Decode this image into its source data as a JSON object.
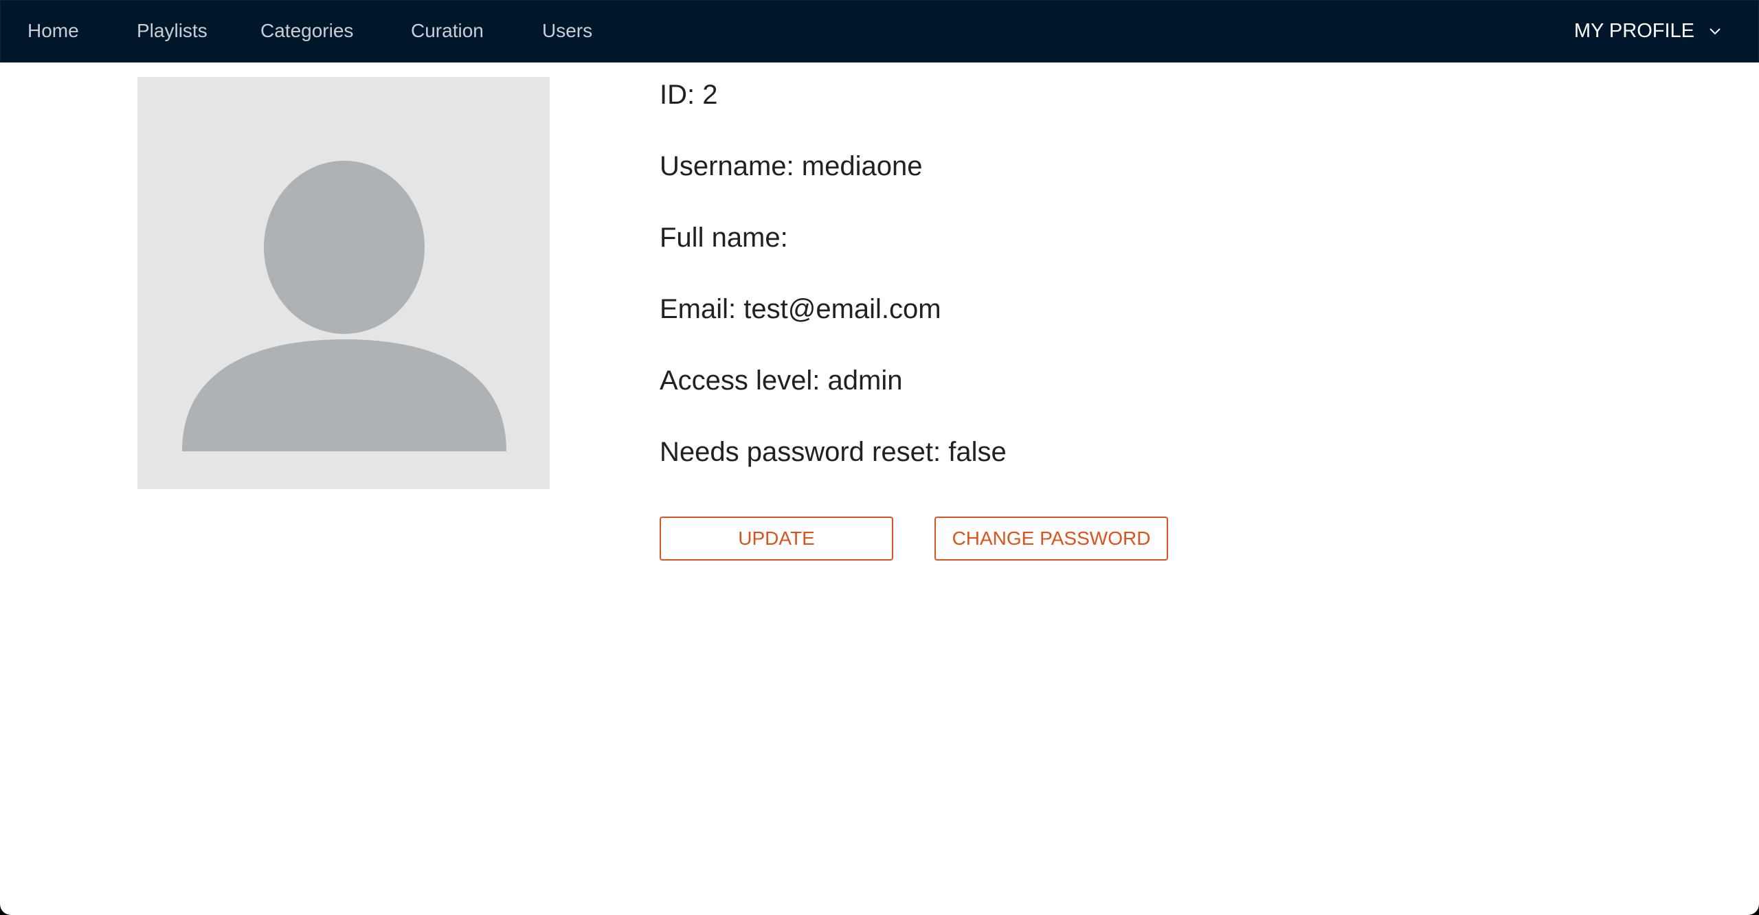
{
  "nav": {
    "items": [
      {
        "label": "Home"
      },
      {
        "label": "Playlists"
      },
      {
        "label": "Categories"
      },
      {
        "label": "Curation"
      },
      {
        "label": "Users"
      }
    ],
    "profile_label": "MY PROFILE",
    "profile_icon": "chevron-down-icon"
  },
  "profile": {
    "avatar_icon": "user-placeholder-icon",
    "fields": [
      {
        "label": "ID:",
        "value": "2"
      },
      {
        "label": "Username:",
        "value": "mediaone"
      },
      {
        "label": "Full name:",
        "value": ""
      },
      {
        "label": "Email:",
        "value": "test@email.com"
      },
      {
        "label": "Access level:",
        "value": "admin"
      },
      {
        "label": "Needs password reset:",
        "value": "false"
      }
    ]
  },
  "actions": {
    "update_label": "UPDATE",
    "change_password_label": "CHANGE PASSWORD"
  },
  "colors": {
    "navbar_bg": "#00172b",
    "accent": "#d9541e",
    "avatar_bg": "#e4e5e7",
    "avatar_fg": "#aeb2b5"
  }
}
